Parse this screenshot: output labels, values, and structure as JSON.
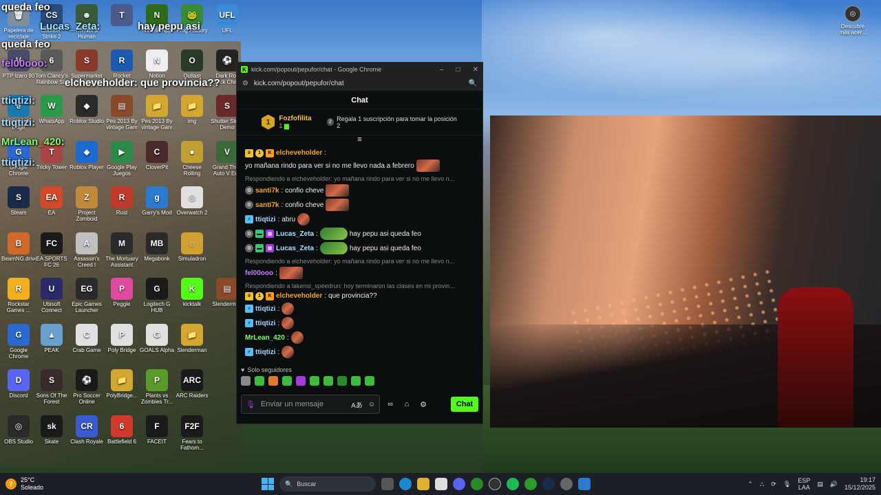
{
  "desktop_icons": [
    {
      "label": "Papelera de reciclaje",
      "color": "#7e8fa0",
      "glyph": "🗑",
      "col": 0,
      "row": 0
    },
    {
      "label": "Counter-Strike 2",
      "color": "#2b4a7a",
      "glyph": "CS",
      "col": 1,
      "row": 0
    },
    {
      "label": "I'm Not a Human",
      "color": "#3a5a3a",
      "glyph": "☻",
      "col": 2,
      "row": 0
    },
    {
      "label": "",
      "color": "#4a5a8a",
      "glyph": "T",
      "col": 3,
      "row": 0
    },
    {
      "label": "NVIDIA App",
      "color": "#2d6a1a",
      "glyph": "N",
      "col": 4,
      "row": 0
    },
    {
      "label": "Frog Factory",
      "color": "#3a8a3a",
      "glyph": "🐸",
      "col": 5,
      "row": 0
    },
    {
      "label": "UFL",
      "color": "#3a8ad6",
      "glyph": "UFL",
      "col": 6,
      "row": 0
    },
    {
      "label": "PTP Icaro 90",
      "color": "#4a4a6a",
      "glyph": "V",
      "col": 0,
      "row": 1
    },
    {
      "label": "Tom Clancy's Rainbow Six",
      "color": "#5a5a5a",
      "glyph": "6",
      "col": 1,
      "row": 1
    },
    {
      "label": "Supermarket Simulator",
      "color": "#8a3a2a",
      "glyph": "S",
      "col": 2,
      "row": 1
    },
    {
      "label": "Rocket League",
      "color": "#1a5ab0",
      "glyph": "R",
      "col": 3,
      "row": 1
    },
    {
      "label": "Notion",
      "color": "#eeeeee",
      "glyph": "N",
      "col": 4,
      "row": 1
    },
    {
      "label": "Outlast",
      "color": "#2a3a2a",
      "glyph": "O",
      "col": 5,
      "row": 1
    },
    {
      "label": "Dark Roll Kick Chall",
      "color": "#222222",
      "glyph": "⚽",
      "col": 6,
      "row": 1
    },
    {
      "label": "Microsoft Edge",
      "color": "#1a7ab0",
      "glyph": "e",
      "col": 0,
      "row": 2
    },
    {
      "label": "WhatsApp",
      "color": "#2a9a4a",
      "glyph": "W",
      "col": 1,
      "row": 2
    },
    {
      "label": "Roblox Studio",
      "color": "#2a2a2a",
      "glyph": "◆",
      "col": 2,
      "row": 2
    },
    {
      "label": "Pes 2013 By vintage Gam",
      "color": "#8a4a2a",
      "glyph": "▤",
      "col": 3,
      "row": 2
    },
    {
      "label": "Pes 2013 By vintage Gam",
      "color": "#d4a830",
      "glyph": "📁",
      "col": 4,
      "row": 2
    },
    {
      "label": "img",
      "color": "#d4a830",
      "glyph": "📁",
      "col": 5,
      "row": 2
    },
    {
      "label": "Shutter Stock Demo",
      "color": "#6a2a2a",
      "glyph": "S",
      "col": 6,
      "row": 2
    },
    {
      "label": "Google Chrome",
      "color": "#2a6ad0",
      "glyph": "G",
      "col": 0,
      "row": 3
    },
    {
      "label": "Tricky Tower",
      "color": "#aa4444",
      "glyph": "T",
      "col": 1,
      "row": 3
    },
    {
      "label": "Roblox Player",
      "color": "#1a6ad0",
      "glyph": "◆",
      "col": 2,
      "row": 3
    },
    {
      "label": "Google Play Juegos",
      "color": "#2a8a4a",
      "glyph": "▶",
      "col": 3,
      "row": 3
    },
    {
      "label": "CloverPit",
      "color": "#4a2a2a",
      "glyph": "C",
      "col": 4,
      "row": 3
    },
    {
      "label": "Cheese Rolling",
      "color": "#c0a030",
      "glyph": "●",
      "col": 5,
      "row": 3
    },
    {
      "label": "Grand Theft Auto V Enh",
      "color": "#3a6a3a",
      "glyph": "V",
      "col": 6,
      "row": 3
    },
    {
      "label": "Steam",
      "color": "#1a2a4a",
      "glyph": "S",
      "col": 0,
      "row": 4
    },
    {
      "label": "EA",
      "color": "#d04a2a",
      "glyph": "EA",
      "col": 1,
      "row": 4
    },
    {
      "label": "Project Zomboid",
      "color": "#c08a3a",
      "glyph": "Z",
      "col": 2,
      "row": 4
    },
    {
      "label": "Rust",
      "color": "#c03a2a",
      "glyph": "R",
      "col": 3,
      "row": 4
    },
    {
      "label": "Garry's Mod",
      "color": "#2a7ad0",
      "glyph": "g",
      "col": 4,
      "row": 4
    },
    {
      "label": "Overwatch 2",
      "color": "#e0e0e0",
      "glyph": "◎",
      "col": 5,
      "row": 4
    },
    {
      "label": "BeamNG.drive",
      "color": "#d06a2a",
      "glyph": "B",
      "col": 0,
      "row": 5
    },
    {
      "label": "EA SPORTS FC 26",
      "color": "#1a1a1a",
      "glyph": "FC",
      "col": 1,
      "row": 5
    },
    {
      "label": "Assassin's Creed I",
      "color": "#c0c0c0",
      "glyph": "A",
      "col": 2,
      "row": 5
    },
    {
      "label": "The Mortuary Assistant",
      "color": "#2a2a2a",
      "glyph": "M",
      "col": 3,
      "row": 5
    },
    {
      "label": "Megabonk",
      "color": "#2a2a2a",
      "glyph": "MB",
      "col": 4,
      "row": 5
    },
    {
      "label": "Simuladron",
      "color": "#d0a030",
      "glyph": "☼",
      "col": 5,
      "row": 5
    },
    {
      "label": "Rockstar Games ...",
      "color": "#f0b020",
      "glyph": "R",
      "col": 0,
      "row": 6
    },
    {
      "label": "Ubisoft Connect",
      "color": "#2a2a6a",
      "glyph": "U",
      "col": 1,
      "row": 6
    },
    {
      "label": "Epic Games Launcher",
      "color": "#2a2a2a",
      "glyph": "EG",
      "col": 2,
      "row": 6
    },
    {
      "label": "Peggle",
      "color": "#e04aa0",
      "glyph": "P",
      "col": 3,
      "row": 6
    },
    {
      "label": "Logitech G HUB",
      "color": "#1a1a1a",
      "glyph": "G",
      "col": 4,
      "row": 6
    },
    {
      "label": "kicktalk",
      "color": "#53fc18",
      "glyph": "K",
      "col": 5,
      "row": 6
    },
    {
      "label": "Slenderman",
      "color": "#8a4a2a",
      "glyph": "▤",
      "col": 6,
      "row": 6
    },
    {
      "label": "Google Chrome",
      "color": "#2a6ad0",
      "glyph": "G",
      "col": 0,
      "row": 7
    },
    {
      "label": "PEAK",
      "color": "#6aa0d0",
      "glyph": "▲",
      "col": 1,
      "row": 7
    },
    {
      "label": "Crab Game",
      "color": "#e0e0e0",
      "glyph": "C",
      "col": 2,
      "row": 7
    },
    {
      "label": "Poly Bridge",
      "color": "#e0e0e0",
      "glyph": "P",
      "col": 3,
      "row": 7
    },
    {
      "label": "GOALS Alpha",
      "color": "#e0e0e0",
      "glyph": "G",
      "col": 4,
      "row": 7
    },
    {
      "label": "Slenderman",
      "color": "#d4a830",
      "glyph": "📁",
      "col": 5,
      "row": 7
    },
    {
      "label": "Discord",
      "color": "#5865f2",
      "glyph": "D",
      "col": 0,
      "row": 8
    },
    {
      "label": "Sons Of The Forest",
      "color": "#3a2a2a",
      "glyph": "S",
      "col": 1,
      "row": 8
    },
    {
      "label": "Pro Soccer Online",
      "color": "#1a1a1a",
      "glyph": "⚽",
      "col": 2,
      "row": 8
    },
    {
      "label": "PolyBridge...",
      "color": "#d4a830",
      "glyph": "📁",
      "col": 3,
      "row": 8
    },
    {
      "label": "Plants vs Zombies Tr...",
      "color": "#5a9a2a",
      "glyph": "P",
      "col": 4,
      "row": 8
    },
    {
      "label": "ARC Raiders",
      "color": "#1a1a1a",
      "glyph": "ARC",
      "col": 5,
      "row": 8
    },
    {
      "label": "OBS Studio",
      "color": "#2a2a2a",
      "glyph": "◎",
      "col": 0,
      "row": 9
    },
    {
      "label": "Skate",
      "color": "#1a1a1a",
      "glyph": "sk",
      "col": 1,
      "row": 9
    },
    {
      "label": "Clash Royale",
      "color": "#3a5ad0",
      "glyph": "CR",
      "col": 2,
      "row": 9
    },
    {
      "label": "Battlefield 6",
      "color": "#d03a2a",
      "glyph": "6",
      "col": 3,
      "row": 9
    },
    {
      "label": "FACEIT",
      "color": "#1a1a1a",
      "glyph": "F",
      "col": 4,
      "row": 9
    },
    {
      "label": "Fears to Fathom...",
      "color": "#1a1a1a",
      "glyph": "F2F",
      "col": 5,
      "row": 9
    }
  ],
  "overlay_texts": [
    {
      "text": "queda feo",
      "color": "#ffffff"
    },
    {
      "text": "Lucas_Zeta:",
      "color": "#a6e3ff"
    },
    {
      "text": "hay pepu asi",
      "color": "#ffffff"
    },
    {
      "text": "queda feo",
      "color": "#ffffff"
    },
    {
      "text": "fel00ooo:",
      "color": "#c77dff"
    },
    {
      "text": "elcheveholder: que provincia??",
      "color": "#ffffff"
    },
    {
      "text": "ttiqtizi:",
      "color": "#a6d8ff"
    },
    {
      "text": "ttiqtizi:",
      "color": "#a6d8ff"
    },
    {
      "text": "MrLean_420:",
      "color": "#7dff6a"
    },
    {
      "text": "ttiqtizi:",
      "color": "#a6d8ff"
    }
  ],
  "discover": {
    "label": "Descubre más acer..."
  },
  "window": {
    "title": "kick.com/popout/pepufor/chat - Google Chrome",
    "url": "kick.com/popout/pepufor/chat",
    "controls": {
      "minimize": "–",
      "maximize": "□",
      "close": "✕"
    },
    "chat_header": "Chat",
    "pinned": {
      "rank": "1",
      "name": "Fozfofilita",
      "sub": "1",
      "rank2": "2",
      "gift_text": "Regala 1 suscripción para tomar la posición 2"
    },
    "pause_icon": "≡"
  },
  "messages": [
    {
      "type": "msg",
      "badges": [
        "crown",
        "num",
        "kick"
      ],
      "user": "elcheveholder",
      "color": "#f5a623",
      "text": "yo mañana rindo para ver si no me llevo nada a febrero",
      "emote": "e"
    },
    {
      "type": "reply",
      "text": "Respondiendo a elcheveholder: yo mañana rindo para ver si no me llevo n..."
    },
    {
      "type": "msg",
      "badges": [
        "gray"
      ],
      "user": "santi7k",
      "color": "#f5a623",
      "text": "confio cheve",
      "emote": "e"
    },
    {
      "type": "msg",
      "badges": [
        "gray"
      ],
      "user": "santi7k",
      "color": "#f5a623",
      "text": "confio cheve",
      "emote": "e"
    },
    {
      "type": "msg",
      "badges": [
        "sub"
      ],
      "user": "ttiqtizi",
      "color": "#a6d8ff",
      "text": "abru",
      "emote": "s"
    },
    {
      "type": "msg",
      "badges": [
        "gray",
        "grn",
        "pur"
      ],
      "user": "Lucas_Zeta",
      "color": "#a6e3ff",
      "text": "hay pepu asi queda feo",
      "emote": "frog"
    },
    {
      "type": "msg",
      "badges": [
        "gray",
        "grn",
        "pur"
      ],
      "user": "Lucas_Zeta",
      "color": "#a6e3ff",
      "text": "hay pepu asi queda feo",
      "emote": "frog"
    },
    {
      "type": "reply",
      "text": "Respondiendo a elcheveholder: yo mañana rindo para ver si no me llevo n..."
    },
    {
      "type": "msg",
      "badges": [],
      "user": "fel00ooo",
      "color": "#c77dff",
      "text": "",
      "emote": "e"
    },
    {
      "type": "reply",
      "text": "Respondiendo a lakensi_speedrun: hoy terminaron las clases en mi provin..."
    },
    {
      "type": "msg",
      "badges": [
        "crown",
        "num",
        "kick"
      ],
      "user": "elcheveholder",
      "color": "#f5a623",
      "text": "que provincia??",
      "emote": ""
    },
    {
      "type": "msg",
      "badges": [
        "sub"
      ],
      "user": "ttiqtizi",
      "color": "#a6d8ff",
      "text": "",
      "emote": "s"
    },
    {
      "type": "msg",
      "badges": [
        "sub"
      ],
      "user": "ttiqtizi",
      "color": "#a6d8ff",
      "text": "",
      "emote": "s"
    },
    {
      "type": "msg",
      "badges": [],
      "user": "MrLean_420",
      "color": "#7dff6a",
      "text": "",
      "emote": "s"
    },
    {
      "type": "msg",
      "badges": [
        "sub"
      ],
      "user": "ttiqtizi",
      "color": "#a6d8ff",
      "text": "",
      "emote": "s"
    }
  ],
  "followers": {
    "icon": "♥",
    "text": "Solo seguidores"
  },
  "input": {
    "placeholder": "Enviar un mensaje",
    "send_label": "Chat"
  },
  "taskbar": {
    "weather_badge": "7",
    "temperature": "25°C",
    "condition": "Soleado",
    "search_placeholder": "Buscar",
    "lang": "ESP",
    "region": "LAA",
    "time": "19:17",
    "date": "15/12/2025"
  }
}
